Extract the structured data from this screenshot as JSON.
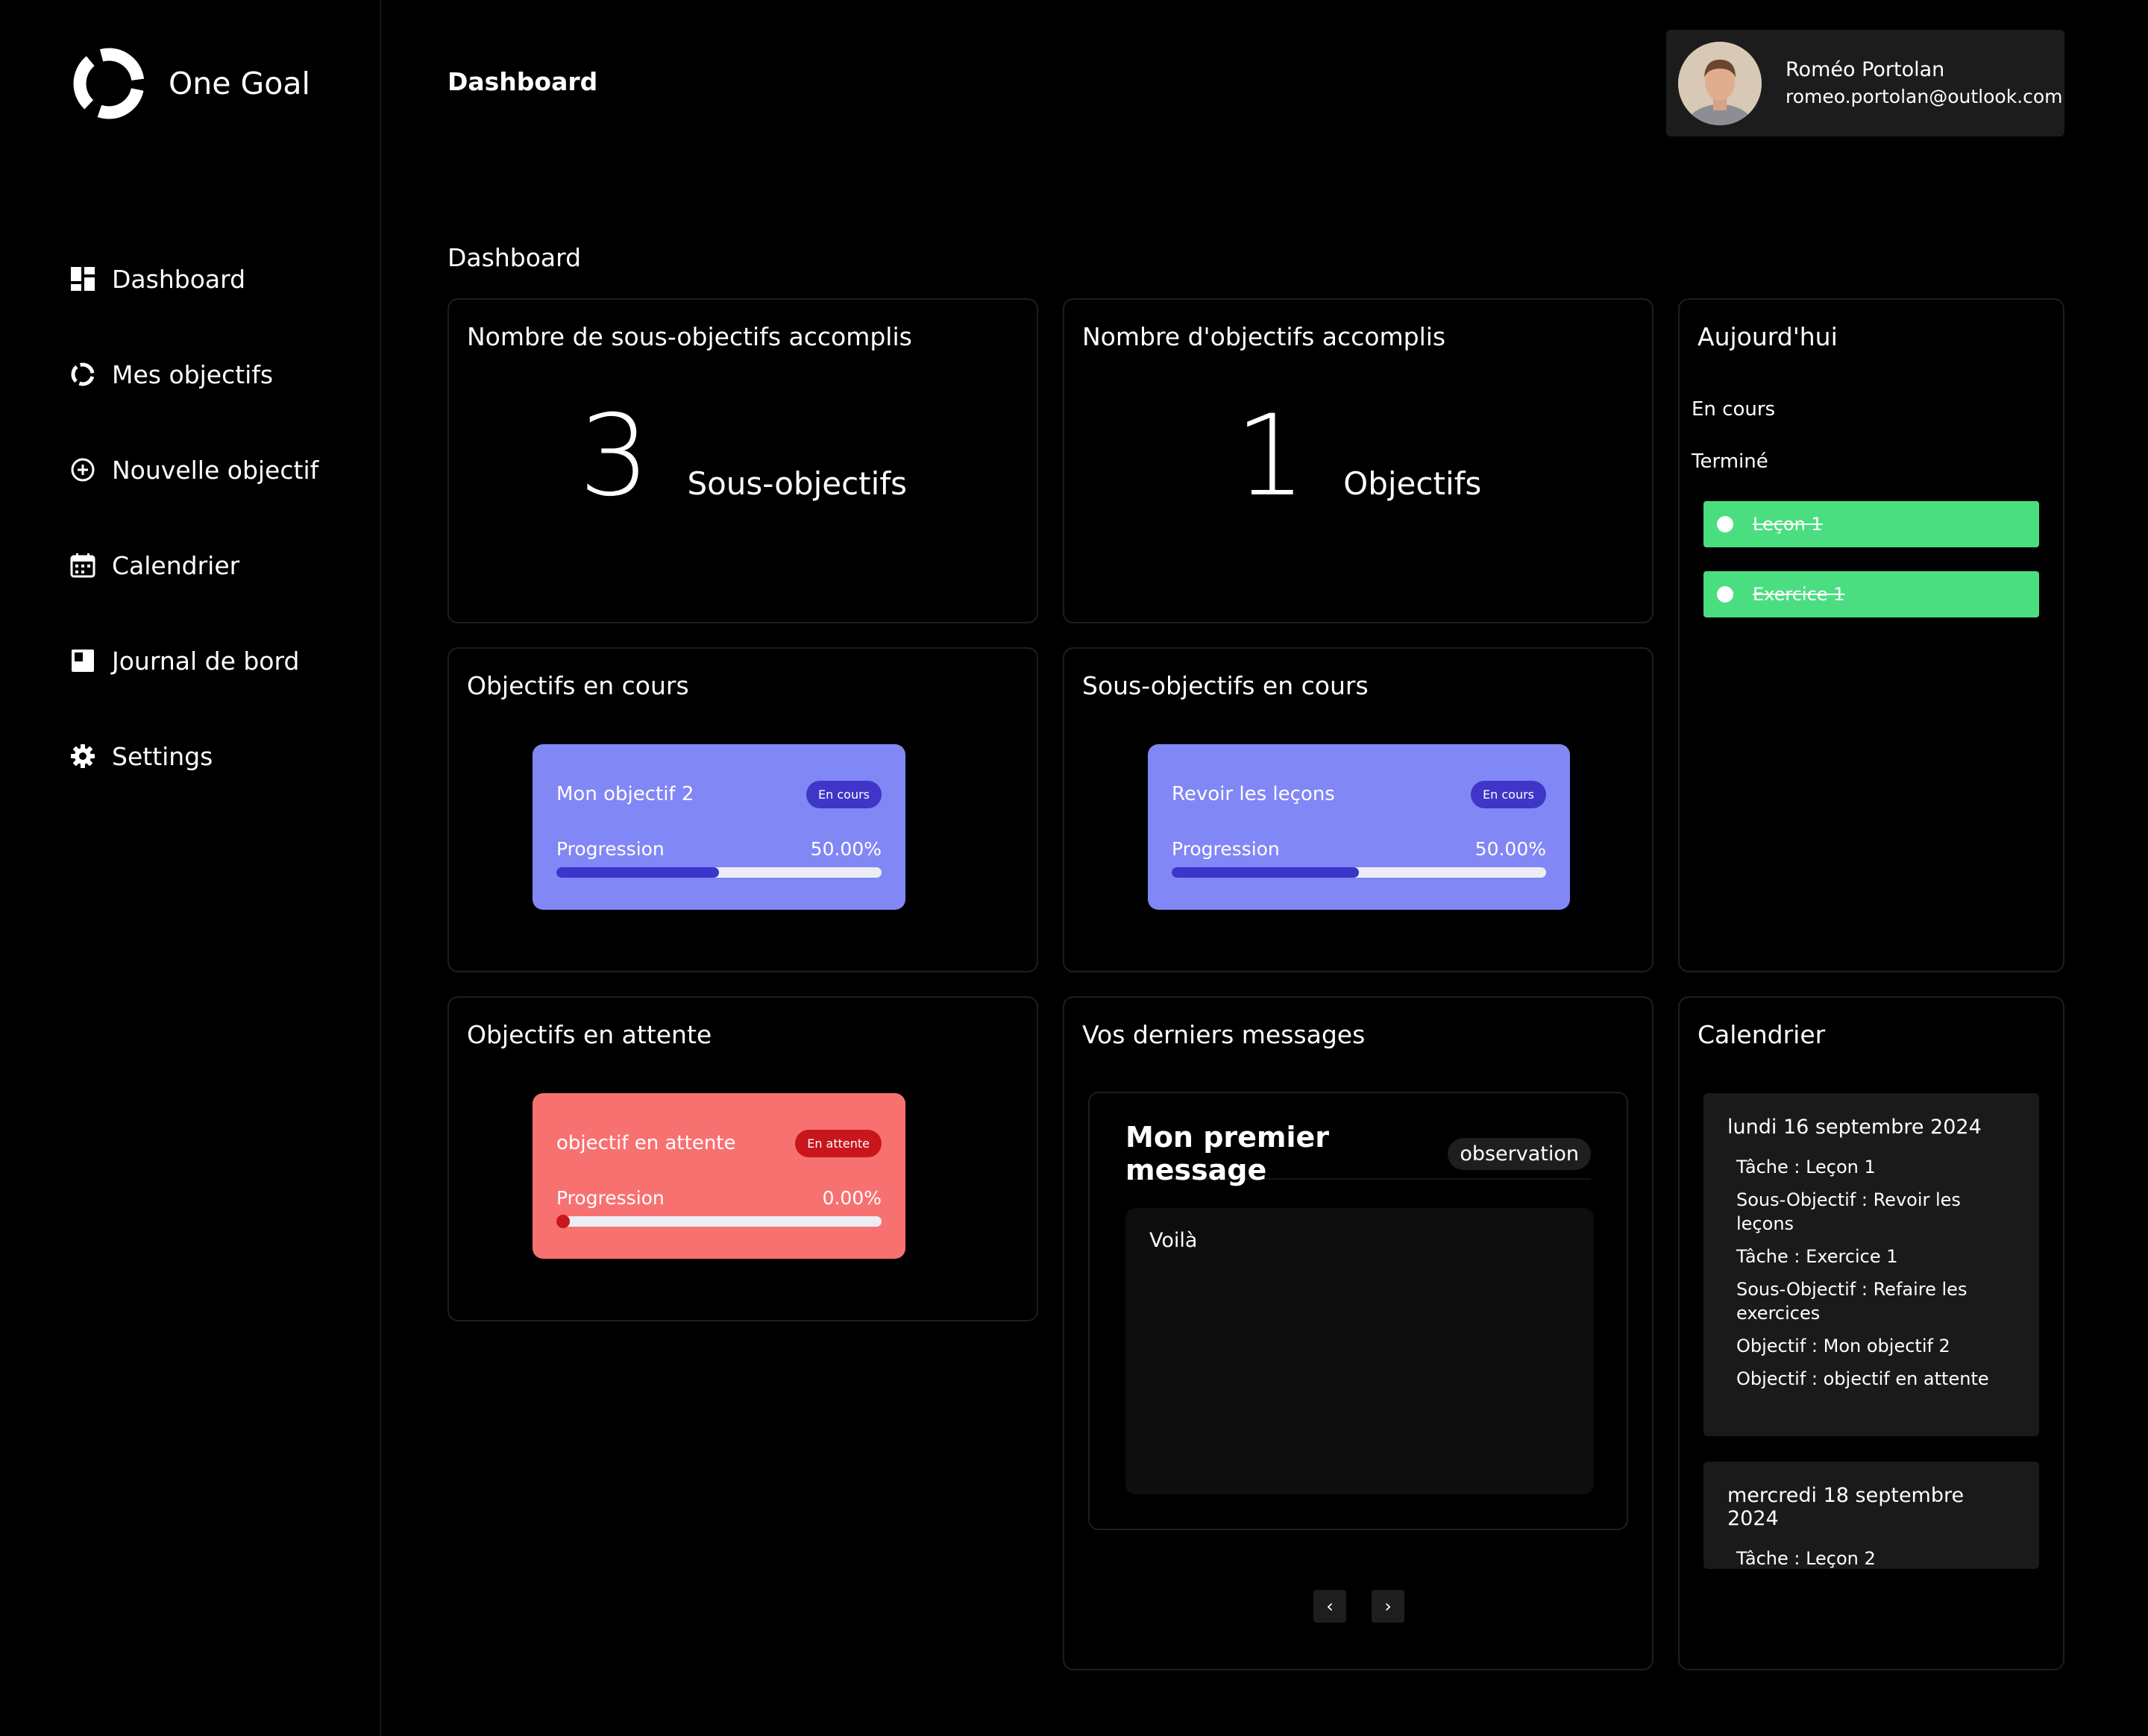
{
  "app": {
    "name": "One Goal"
  },
  "sidebar": {
    "items": [
      {
        "label": "Dashboard",
        "icon": "dashboard-icon"
      },
      {
        "label": "Mes objectifs",
        "icon": "goals-icon"
      },
      {
        "label": "Nouvelle objectif",
        "icon": "plus-circle-icon"
      },
      {
        "label": "Calendrier",
        "icon": "calendar-icon"
      },
      {
        "label": "Journal de bord",
        "icon": "journal-icon"
      },
      {
        "label": "Settings",
        "icon": "gear-icon"
      }
    ]
  },
  "header": {
    "title": "Dashboard",
    "user": {
      "name": "Roméo Portolan",
      "email": "romeo.portolan@outlook.com"
    }
  },
  "main": {
    "section_title": "Dashboard",
    "subgoals_done": {
      "title": "Nombre de sous-objectifs accomplis",
      "count": "3",
      "unit": "Sous-objectifs"
    },
    "goals_done": {
      "title": "Nombre d'objectifs accomplis",
      "count": "1",
      "unit": "Objectifs"
    },
    "today": {
      "title": "Aujourd'hui",
      "in_progress_label": "En cours",
      "done_label": "Terminé",
      "done_items": [
        "Leçon 1",
        "Exercice 1"
      ]
    },
    "goals_in_progress": {
      "title": "Objectifs en cours",
      "card": {
        "name": "Mon objectif 2",
        "status": "En cours",
        "progress_label": "Progression",
        "progress_text": "50.00%",
        "progress": 0.5
      }
    },
    "subgoals_in_progress": {
      "title": "Sous-objectifs en cours",
      "card": {
        "name": "Revoir les leçons",
        "status": "En cours",
        "progress_label": "Progression",
        "progress_text": "50.00%",
        "progress": 0.5
      }
    },
    "goals_pending": {
      "title": "Objectifs en attente",
      "card": {
        "name": "objectif en attente",
        "status": "En attente",
        "progress_label": "Progression",
        "progress_text": "0.00%",
        "progress": 0
      }
    },
    "messages": {
      "title": "Vos derniers messages",
      "message": {
        "title": "Mon premier message",
        "tag": "observation",
        "body": "Voilà"
      },
      "prev": "‹",
      "next": "›"
    },
    "calendar": {
      "title": "Calendrier",
      "days": [
        {
          "date": "lundi 16 septembre 2024",
          "items": [
            "Tâche : Leçon 1",
            "Sous-Objectif : Revoir les leçons",
            "Tâche : Exercice 1",
            "Sous-Objectif : Refaire les exercices",
            "Objectif : Mon objectif 2",
            "Objectif : objectif en attente"
          ]
        },
        {
          "date": "mercredi 18 septembre 2024",
          "items": [
            "Tâche : Leçon 2"
          ]
        }
      ]
    }
  },
  "colors": {
    "accent_blue": "#8187f5",
    "accent_red": "#f87171",
    "done_green": "#4ade80",
    "progress_fill": "#3c35c9"
  }
}
